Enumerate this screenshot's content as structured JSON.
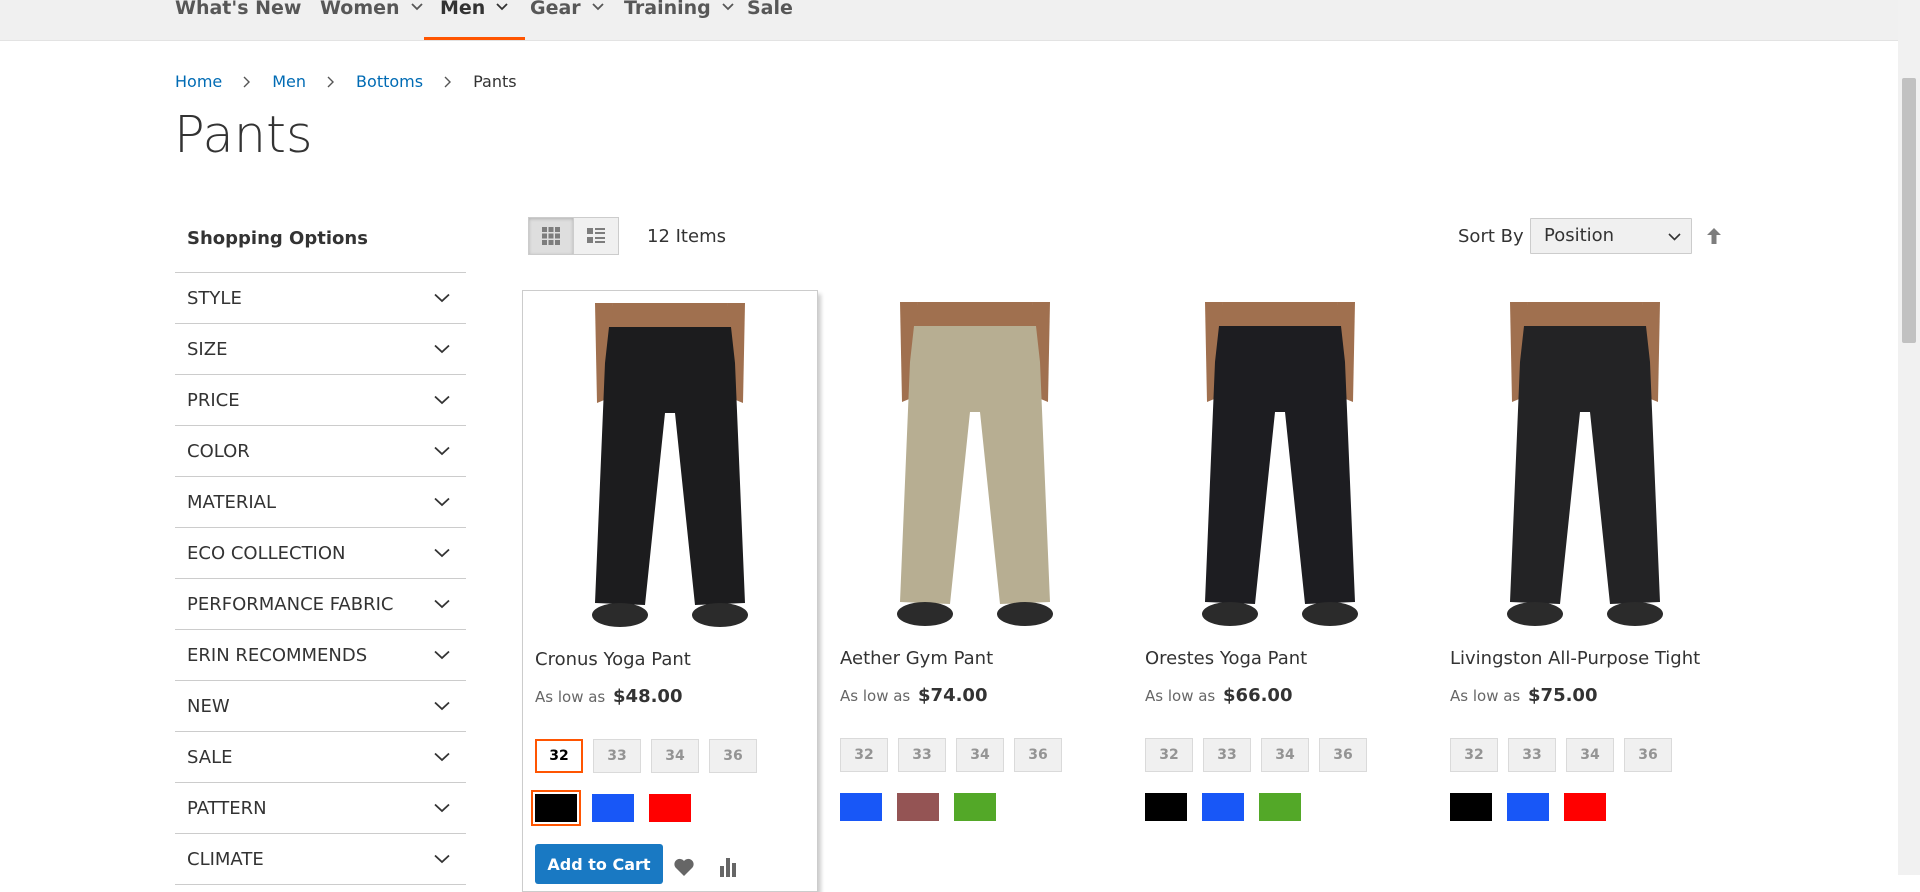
{
  "nav": {
    "items": [
      {
        "label": "What's New"
      },
      {
        "label": "Women"
      },
      {
        "label": "Men"
      },
      {
        "label": "Gear"
      },
      {
        "label": "Training"
      },
      {
        "label": "Sale"
      }
    ],
    "active": "Men"
  },
  "breadcrumb": [
    "Home",
    "Men",
    "Bottoms",
    "Pants"
  ],
  "page_title": "Pants",
  "sidebar": {
    "title": "Shopping Options",
    "filters": [
      "STYLE",
      "SIZE",
      "PRICE",
      "COLOR",
      "MATERIAL",
      "ECO COLLECTION",
      "PERFORMANCE FABRIC",
      "ERIN RECOMMENDS",
      "NEW",
      "SALE",
      "PATTERN",
      "CLIMATE"
    ]
  },
  "toolbar": {
    "items_count": "12 Items",
    "sort_label": "Sort By",
    "sort_value": "Position"
  },
  "products": [
    {
      "name": "Cronus Yoga Pant",
      "price_prefix": "As low as",
      "price": "$48.00",
      "sizes": [
        "32",
        "33",
        "34",
        "36"
      ],
      "selected_size": "32",
      "swatches": [
        "#000000",
        "#1857f7",
        "#ff0000"
      ],
      "selected_swatch": 0,
      "pant_color": "#1c1c1e",
      "add_to_cart": "Add to Cart"
    },
    {
      "name": "Aether Gym Pant",
      "price_prefix": "As low as",
      "price": "$74.00",
      "sizes": [
        "32",
        "33",
        "34",
        "36"
      ],
      "swatches": [
        "#1857f7",
        "#945454",
        "#53a828"
      ],
      "pant_color": "#b7ae92"
    },
    {
      "name": "Orestes Yoga Pant",
      "price_prefix": "As low as",
      "price": "$66.00",
      "sizes": [
        "32",
        "33",
        "34",
        "36"
      ],
      "swatches": [
        "#000000",
        "#1857f7",
        "#53a828"
      ],
      "pant_color": "#1d1d21"
    },
    {
      "name": "Livingston All-Purpose Tight",
      "price_prefix": "As low as",
      "price": "$75.00",
      "sizes": [
        "32",
        "33",
        "34",
        "36"
      ],
      "swatches": [
        "#000000",
        "#1857f7",
        "#ff0000"
      ],
      "pant_color": "#232325"
    }
  ],
  "colors": {
    "accent": "#ff5501",
    "link": "#006bb4",
    "button": "#1979c3"
  }
}
